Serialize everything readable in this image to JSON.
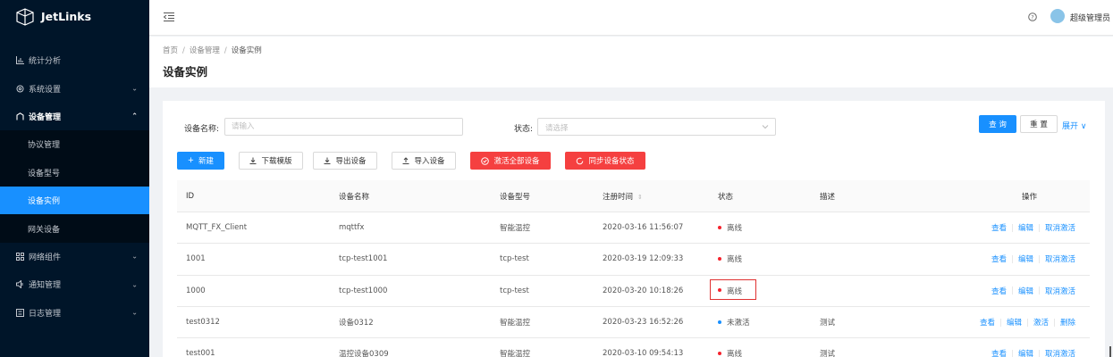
{
  "app": {
    "name": "JetLinks"
  },
  "sidebar": {
    "items": [
      {
        "label": "统计分析",
        "icon": "bar-chart-icon",
        "has_arrow": false
      },
      {
        "label": "系统设置",
        "icon": "gear-icon",
        "has_arrow": true
      },
      {
        "label": "设备管理",
        "icon": "device-icon",
        "has_arrow": true,
        "open": true
      }
    ],
    "sub_items": [
      {
        "label": "协议管理"
      },
      {
        "label": "设备型号"
      },
      {
        "label": "设备实例",
        "selected": true
      },
      {
        "label": "网关设备"
      }
    ],
    "items_after": [
      {
        "label": "网络组件",
        "icon": "grid-icon"
      },
      {
        "label": "通知管理",
        "icon": "speaker-icon"
      },
      {
        "label": "日志管理",
        "icon": "log-icon"
      }
    ]
  },
  "header": {
    "username": "超级管理员"
  },
  "breadcrumb": {
    "home": "首页",
    "level2": "设备管理",
    "current": "设备实例",
    "separator": "/"
  },
  "page": {
    "title": "设备实例"
  },
  "search": {
    "name_label": "设备名称:",
    "name_placeholder": "请输入",
    "status_label": "状态:",
    "status_placeholder": "请选择",
    "query_button": "查 询",
    "reset_button": "重 置",
    "expand_link": "展开"
  },
  "toolbar": {
    "new": "新建",
    "download_template": "下载模版",
    "export": "导出设备",
    "import": "导入设备",
    "activate_all": "激活全部设备",
    "sync_state": "同步设备状态"
  },
  "table": {
    "columns": {
      "id": "ID",
      "name": "设备名称",
      "product": "设备型号",
      "time": "注册时间",
      "state": "状态",
      "desc": "描述",
      "ops": "操作"
    },
    "rows": [
      {
        "id": "MQTT_FX_Client",
        "name": "mqttfx",
        "product": "智能温控",
        "time": "2020-03-16 11:56:07",
        "state": "离线",
        "desc": "",
        "ops": [
          "查看",
          "编辑",
          "取消激活"
        ]
      },
      {
        "id": "1001",
        "name": "tcp-test1001",
        "product": "tcp-test",
        "time": "2020-03-19 12:09:33",
        "state": "离线",
        "desc": "",
        "ops": [
          "查看",
          "编辑",
          "取消激活"
        ]
      },
      {
        "id": "1000",
        "name": "tcp-test1000",
        "product": "tcp-test",
        "time": "2020-03-20 10:18:26",
        "state": "离线",
        "desc": "",
        "ops": [
          "查看",
          "编辑",
          "取消激活"
        ]
      },
      {
        "id": "test0312",
        "name": "设备0312",
        "product": "智能温控",
        "time": "2020-03-23 16:52:26",
        "state": "未激活",
        "desc": "测试",
        "ops": [
          "查看",
          "编辑",
          "激活",
          "删除"
        ]
      },
      {
        "id": "test001",
        "name": "温控设备0309",
        "product": "智能温控",
        "time": "2020-03-10 09:54:13",
        "state": "离线",
        "desc": "测试",
        "ops": [
          "查看",
          "编辑",
          "取消激活"
        ]
      }
    ]
  },
  "colors": {
    "primary": "#1890ff",
    "danger": "#f54040",
    "sidebar": "#001529",
    "offline_dot": "#f5222d",
    "inactive_dot": "#1890ff"
  }
}
